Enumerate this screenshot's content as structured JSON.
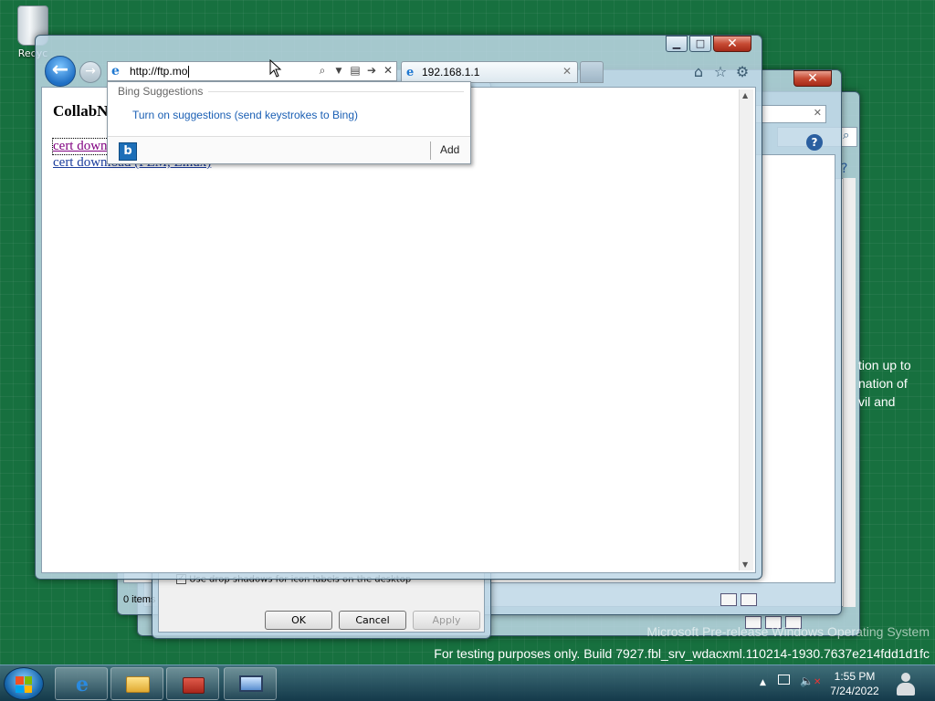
{
  "desktop": {
    "recycle_bin_label": "Recyc",
    "watermark_line1": "Microsoft Pre-release Windows Operating System",
    "watermark_line2": "For testing purposes only. Build 7927.fbl_srv_wdacxml.110214-1930.7637e214fdd1d1fc",
    "side_text": [
      "tion up to",
      "nation of",
      "vil and"
    ]
  },
  "dialog": {
    "checkbox_label": "Use drop shadows for icon labels on the desktop",
    "status_items": "0 items",
    "ok_label": "OK",
    "cancel_label": "Cancel",
    "apply_label": "Apply"
  },
  "browser": {
    "address_value": "http://ftp.mo",
    "tab_title": "192.168.1.1",
    "page_heading": "CollabN",
    "links": [
      "cert down",
      "cert download (PEM, Linux)"
    ],
    "suggestions": {
      "header": "Bing Suggestions",
      "turn_on": "Turn on suggestions (send keystrokes to Bing)",
      "add": "Add",
      "bing_glyph": "b"
    },
    "nav_back_glyph": "←",
    "nav_fwd_glyph": "→",
    "close_glyph": "✕",
    "minimize_glyph": "▁",
    "maximize_glyph": "□"
  },
  "taskbar": {
    "time": "1:55 PM",
    "date": "7/24/2022",
    "tray_up_glyph": "▲"
  },
  "colors": {
    "desktop_green": "#17703f",
    "link_blue": "#1a5fb4",
    "visited_purple": "#800080",
    "close_red": "#c74a33"
  }
}
